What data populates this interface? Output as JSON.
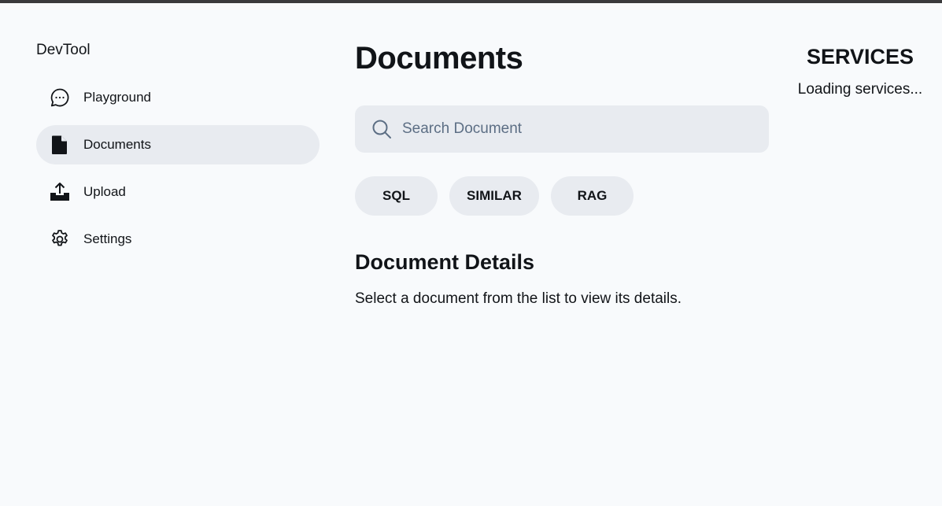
{
  "brand": "DevTool",
  "nav": {
    "items": [
      {
        "label": "Playground",
        "icon": "chat-bubble-icon",
        "active": false
      },
      {
        "label": "Documents",
        "icon": "document-icon",
        "active": true
      },
      {
        "label": "Upload",
        "icon": "upload-icon",
        "active": false
      },
      {
        "label": "Settings",
        "icon": "gear-icon",
        "active": false
      }
    ]
  },
  "main": {
    "title": "Documents",
    "search": {
      "placeholder": "Search Document",
      "value": ""
    },
    "filters": [
      "SQL",
      "SIMILAR",
      "RAG"
    ],
    "details": {
      "title": "Document Details",
      "text": "Select a document from the list to view its details."
    }
  },
  "services": {
    "title": "SERVICES",
    "status": "Loading services..."
  },
  "colors": {
    "background": "#f8fafc",
    "chip_bg": "#e8ebf0",
    "text": "#111418",
    "placeholder": "#5c6e84"
  }
}
